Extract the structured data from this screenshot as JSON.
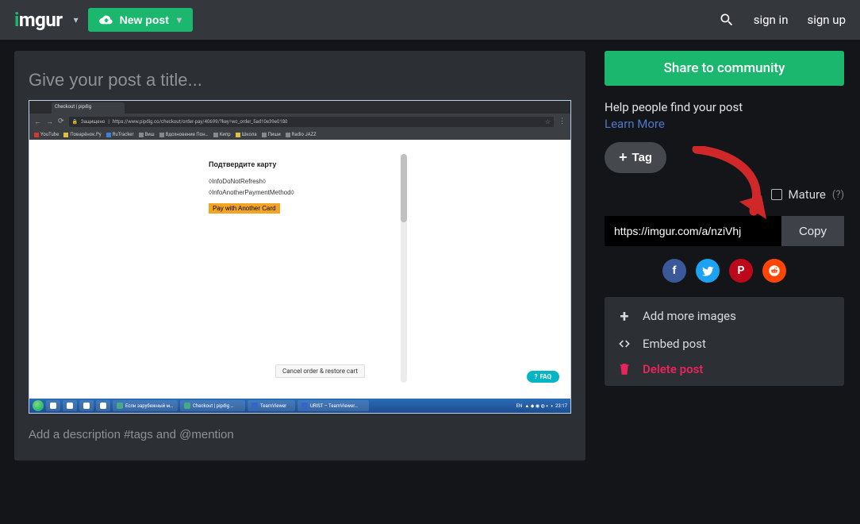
{
  "header": {
    "logo_text": "imgur",
    "new_post_label": "New post",
    "sign_in": "sign in",
    "sign_up": "sign up"
  },
  "editor": {
    "title_placeholder": "Give your post a title...",
    "desc_placeholder": "Add a description #tags and @mention"
  },
  "screenshot": {
    "tab_label": "Checkout | pipdig",
    "url_prefix": "Защищено",
    "url": "https://www.pipdig.co/checkout/order-pay/40699/?key=wc_order_5ad10e39e0180",
    "bookmarks": [
      "YouTube",
      "Поварёнок.Ру",
      "RuTracker",
      "Виш",
      "Вдохновение Пон…",
      "Кипр",
      "Школа",
      "Пиши",
      "Radio JAZZ"
    ],
    "confirm_title": "Подтвердите карту",
    "line1": "◊InfoDoNotRefresh◊",
    "line2": "◊InfoAnotherPaymentMethod◊",
    "pay_btn": "Pay with Another Card",
    "cancel_btn": "Cancel order & restore cart",
    "faq": "FAQ",
    "taskbar": {
      "items": [
        "Если зарубежный м…",
        "Checkout | pipdig …",
        "TeamViewer",
        "URIST – TeamViewer…"
      ],
      "lang": "EN",
      "time": "23:17"
    }
  },
  "sidebar": {
    "share_label": "Share to community",
    "help_title": "Help people find your post",
    "learn_more": "Learn More",
    "tag_label": "Tag",
    "mature_label": "Mature",
    "mature_hint": "(?)",
    "url_value": "https://imgur.com/a/nziVhj",
    "copy_label": "Copy",
    "actions": {
      "add_images": "Add more images",
      "embed": "Embed post",
      "delete": "Delete post"
    }
  }
}
